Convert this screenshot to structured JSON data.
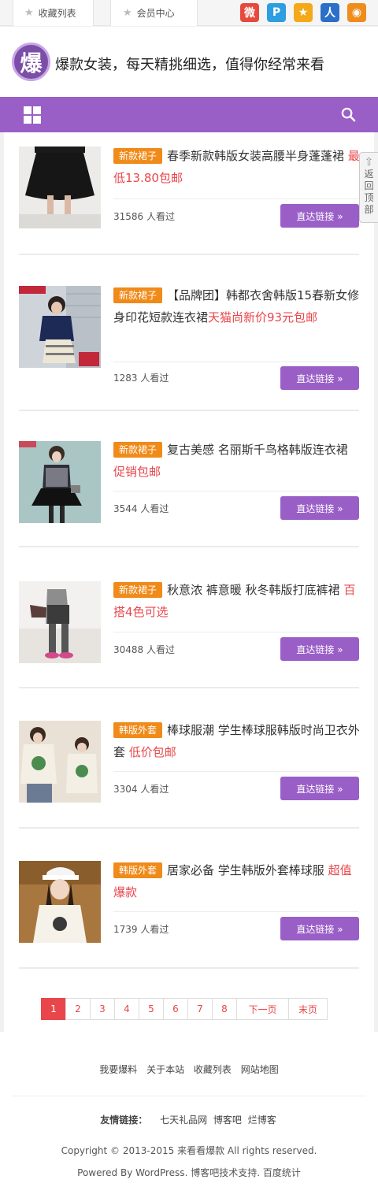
{
  "topbar": {
    "links": [
      {
        "label": "收藏列表",
        "icon": "star-icon"
      },
      {
        "label": "会员中心",
        "icon": "star-icon"
      }
    ],
    "social": [
      {
        "name": "weibo-icon",
        "glyph": "微",
        "color": "#e64a3c"
      },
      {
        "name": "pinterest-icon",
        "glyph": "P",
        "color": "#2d9ee0"
      },
      {
        "name": "qzone-icon",
        "glyph": "★",
        "color": "#f4a91a"
      },
      {
        "name": "renren-icon",
        "glyph": "人",
        "color": "#2b6fc9"
      },
      {
        "name": "rss-icon",
        "glyph": "◉",
        "color": "#f08c1c"
      }
    ]
  },
  "header": {
    "logo_char": "爆",
    "title": "爆款女装，每天精挑细选，值得你经常来看"
  },
  "colors": {
    "accent": "#9a5fc7",
    "tag": "#f08a19",
    "highlight": "#e8464a"
  },
  "back_to_top": "返回顶部",
  "items": [
    {
      "tag": "新款裙子",
      "title": "春季新款韩版女装高腰半身蓬蓬裙",
      "highlight": "最低13.80包邮",
      "views": "31586 人看过",
      "button": "直达链接 »"
    },
    {
      "tag": "新款裙子",
      "title": "【品牌团】韩都衣舍韩版15春新女修身印花短款连衣裙",
      "highlight": "天猫尚新价93元包邮",
      "views": "1283 人看过",
      "button": "直达链接 »"
    },
    {
      "tag": "新款裙子",
      "title": "复古美感 名丽斯千鸟格韩版连衣裙",
      "highlight": "促销包邮",
      "views": "3544 人看过",
      "button": "直达链接 »"
    },
    {
      "tag": "新款裙子",
      "title": "秋意浓 裤意暖 秋冬韩版打底裤裙",
      "highlight": "百搭4色可选",
      "views": "30488 人看过",
      "button": "直达链接 »"
    },
    {
      "tag": "韩版外套",
      "title": "棒球服潮 学生棒球服韩版时尚卫衣外套",
      "highlight": "低价包邮",
      "views": "3304 人看过",
      "button": "直达链接 »"
    },
    {
      "tag": "韩版外套",
      "title": "居家必备 学生韩版外套棒球服",
      "highlight": "超值爆款",
      "views": "1739 人看过",
      "button": "直达链接 »"
    }
  ],
  "pagination": {
    "pages": [
      "1",
      "2",
      "3",
      "4",
      "5",
      "6",
      "7",
      "8"
    ],
    "current": 1,
    "next": "下一页",
    "last": "末页"
  },
  "footer": {
    "links": [
      "我要爆料",
      "关于本站",
      "收藏列表",
      "网站地图"
    ],
    "friends_label": "友情链接：",
    "friends": [
      "七天礼品网",
      "博客吧",
      "烂博客"
    ],
    "copyright": "Copyright © 2013-2015 来看看爆款 All rights reserved.",
    "powered": "Powered By WordPress. 博客吧技术支持. 百度统计"
  }
}
